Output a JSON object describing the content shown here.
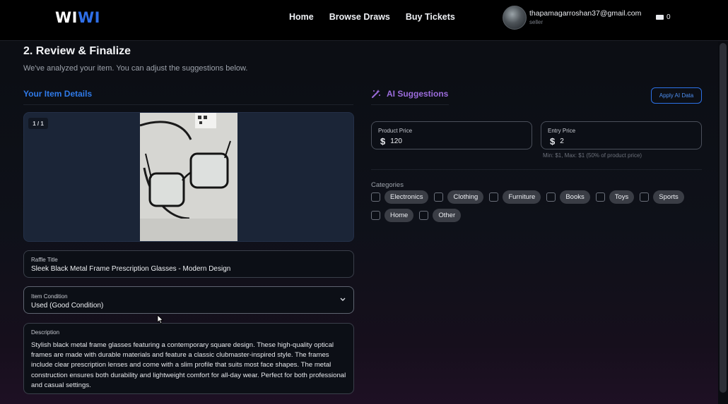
{
  "header": {
    "logo_main": "WI",
    "logo_accent": "WI",
    "nav": [
      "Home",
      "Browse Draws",
      "Buy Tickets"
    ],
    "user": {
      "email": "thapamagarroshan37@gmail.com",
      "role": "seller"
    },
    "cart_count": "0"
  },
  "page": {
    "title": "2. Review & Finalize",
    "subtitle": "We've analyzed your item. You can adjust the suggestions below."
  },
  "item_details": {
    "heading": "Your Item Details",
    "image_counter": "1 / 1",
    "raffle_title_label": "Raffle Title",
    "raffle_title_value": "Sleek Black Metal Frame Prescription Glasses - Modern Design",
    "condition_label": "Item Condition",
    "condition_value": "Used (Good Condition)",
    "description_label": "Description",
    "description_value": "Stylish black metal frame glasses featuring a contemporary square design. These high-quality optical frames are made with durable materials and feature a classic clubmaster-inspired style. The frames include clear prescription lenses and come with a slim profile that suits most face shapes. The metal construction ensures both durability and lightweight comfort for all-day wear. Perfect for both professional and casual settings."
  },
  "ai_suggestions": {
    "heading": "AI Suggestions",
    "apply_button": "Apply AI Data",
    "product_price_label": "Product Price",
    "product_price_value": "120",
    "entry_price_label": "Entry Price",
    "entry_price_value": "2",
    "currency_symbol": "$",
    "price_hint": "Min: $1, Max: $1 (50% of product price)",
    "categories_label": "Categories",
    "categories": [
      "Electronics",
      "Clothing",
      "Furniture",
      "Books",
      "Toys",
      "Sports",
      "Home",
      "Other"
    ]
  },
  "colors": {
    "accent_blue": "#2f7ae8",
    "accent_purple": "#9b6cdc",
    "background": "#0e1119"
  }
}
